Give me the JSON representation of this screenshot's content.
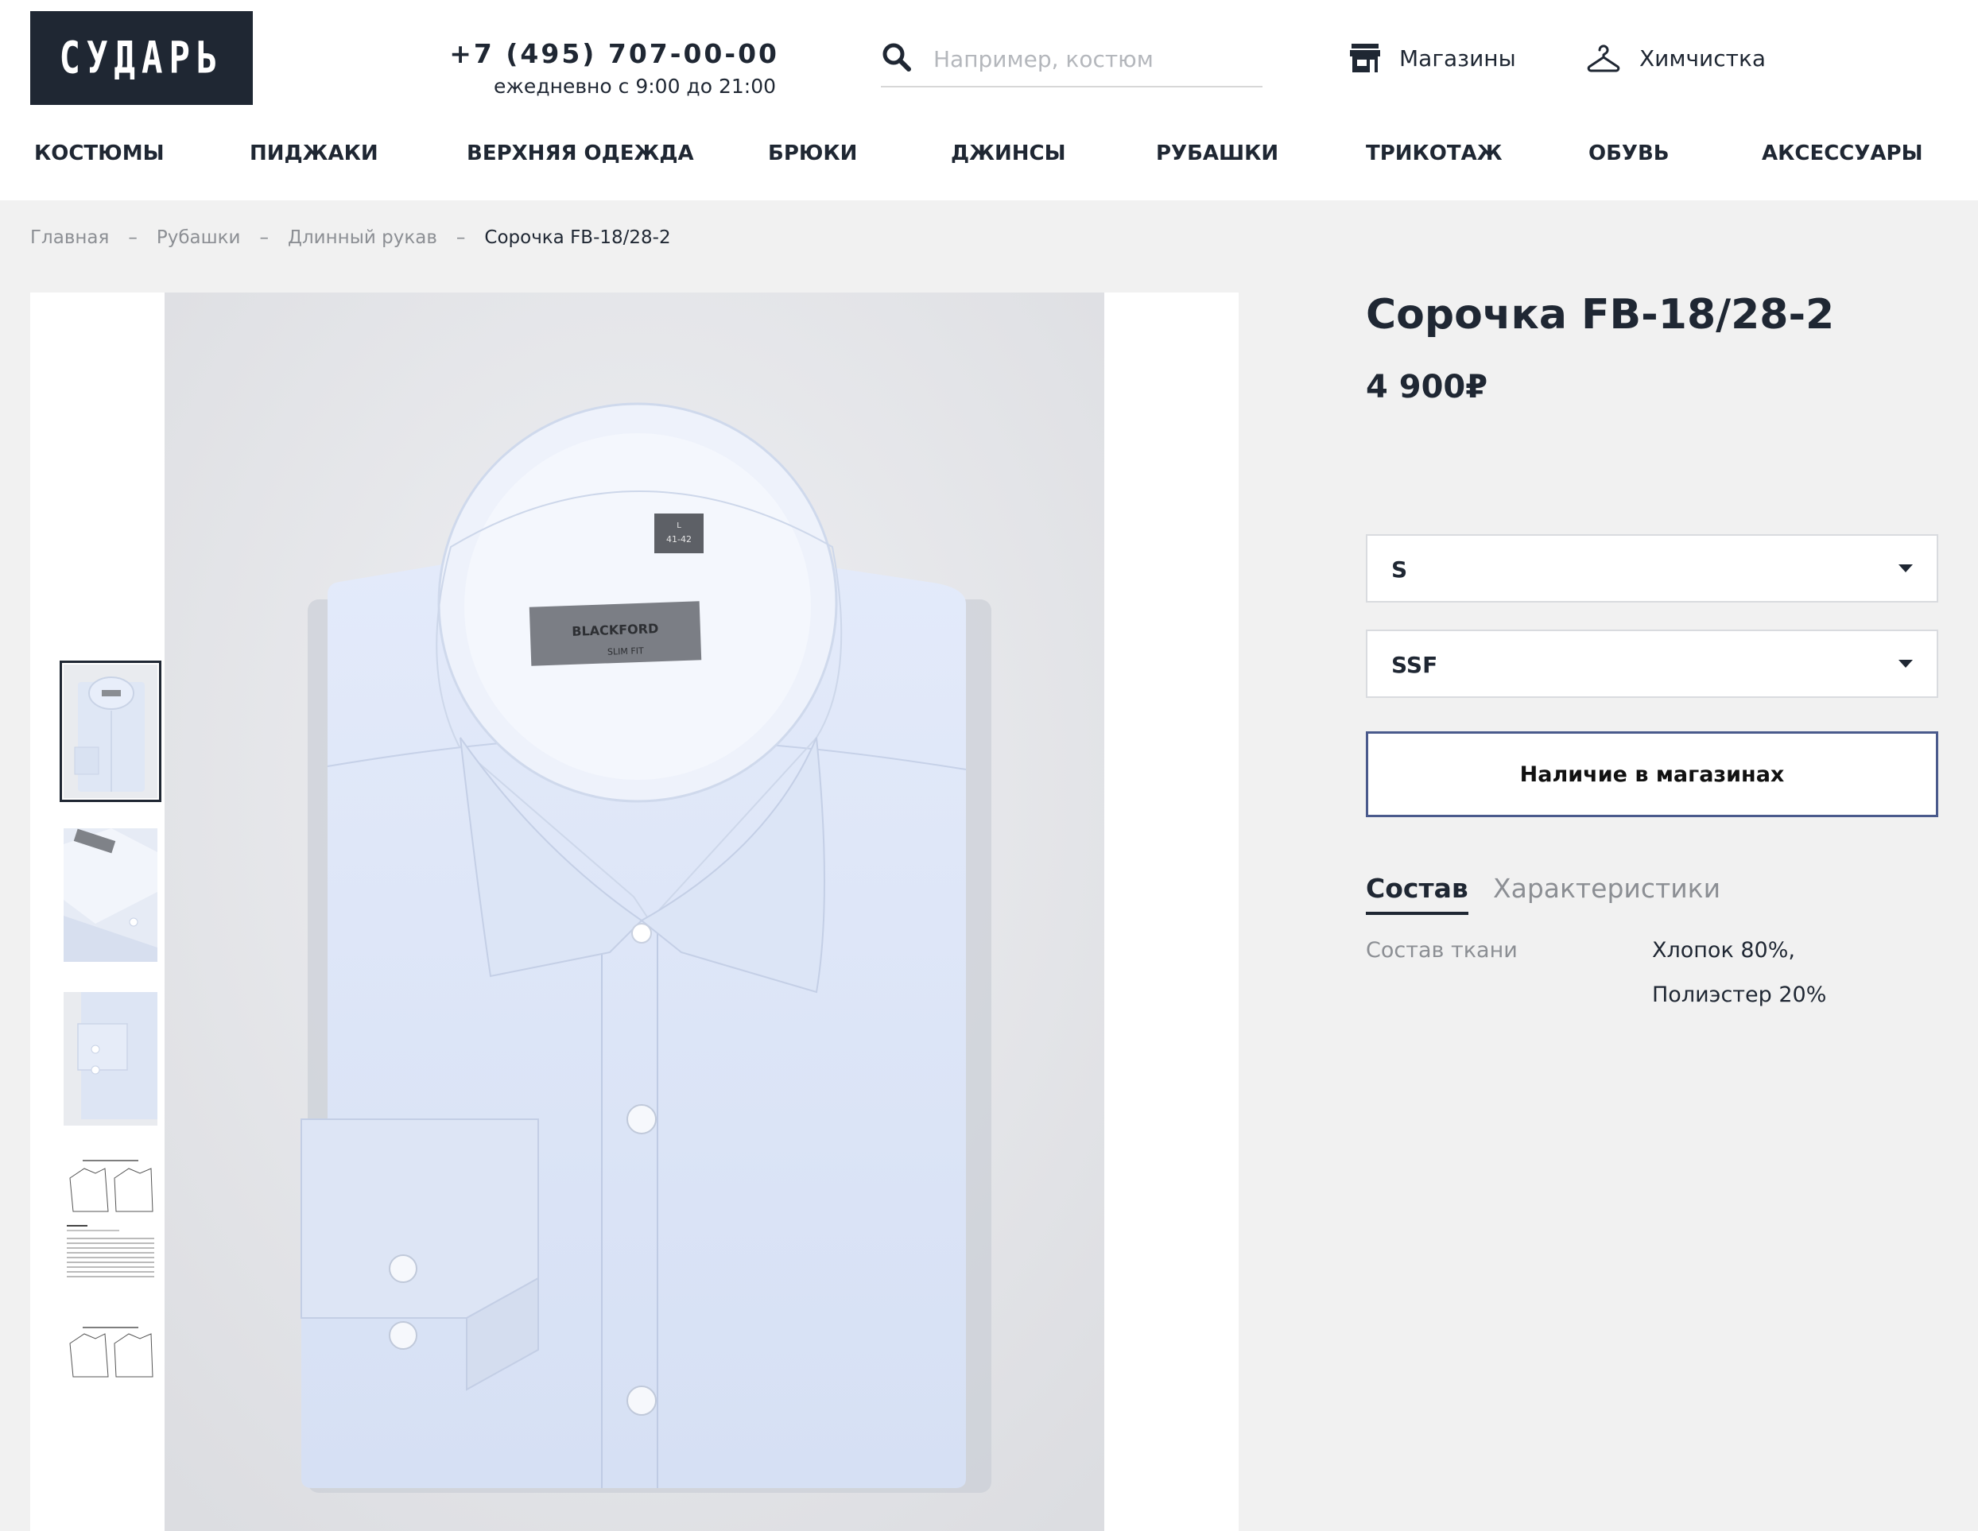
{
  "header": {
    "logo": "СУДАРЬ",
    "phone": "+7 (495) 707-00-00",
    "hours": "ежедневно с 9:00 до 21:00",
    "search_placeholder": "Например, костюм",
    "stores_label": "Магазины",
    "drycleaning_label": "Химчистка"
  },
  "nav": {
    "items": [
      "КОСТЮМЫ",
      "ПИДЖАКИ",
      "ВЕРХНЯЯ ОДЕЖДА",
      "БРЮКИ",
      "ДЖИНСЫ",
      "РУБАШКИ",
      "ТРИКОТАЖ",
      "ОБУВЬ",
      "АКСЕССУАРЫ"
    ]
  },
  "breadcrumb": {
    "items": [
      "Главная",
      "Рубашки",
      "Длинный рукав"
    ],
    "separator": "–",
    "current": "Сорочка FB-18/28-2"
  },
  "photo": {
    "label_brand": "BLACKFORD",
    "label_fit": "SLIM FIT",
    "size_tag_top": "L",
    "size_tag_bottom": "41-42"
  },
  "product": {
    "title": "Сорочка FB-18/28-2",
    "price": "4 900₽",
    "size_select": "S",
    "fit_select": "SSF",
    "availability_button": "Наличие в магазинах"
  },
  "tabs": {
    "items": [
      "Состав",
      "Характеристики"
    ],
    "active": "Состав"
  },
  "composition": {
    "label": "Состав ткани",
    "values": [
      "Хлопок 80%,",
      "Полиэстер 20%"
    ]
  },
  "icons": {
    "search": "search-icon",
    "stores": "store-icon",
    "drycleaning": "hanger-icon"
  },
  "colors": {
    "brand_dark": "#1f2733",
    "accent_border": "#4a5a8c",
    "background": "#f1f1f1",
    "muted_text": "#8c8f94"
  }
}
